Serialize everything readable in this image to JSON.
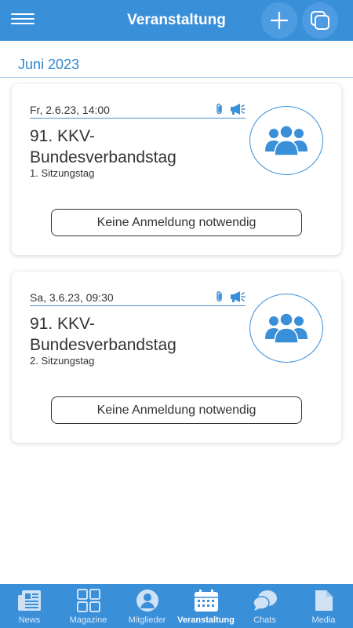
{
  "header": {
    "title": "Veranstaltung",
    "menu_icon": "hamburger-menu-icon",
    "add_icon": "plus-icon",
    "copy_icon": "copy-icon"
  },
  "month": "Juni 2023",
  "events": [
    {
      "datetime": "Fr, 2.6.23, 14:00",
      "title": "91. KKV-Bundesverbandstag",
      "subtitle": "1. Sitzungstag",
      "registration": "Keine Anmeldung notwendig",
      "icons": [
        "paperclip-icon",
        "megaphone-icon",
        "group-icon"
      ]
    },
    {
      "datetime": "Sa, 3.6.23, 09:30",
      "title": "91. KKV-Bundesverbandstag",
      "subtitle": "2. Sitzungstag",
      "registration": "Keine Anmeldung notwendig",
      "icons": [
        "paperclip-icon",
        "megaphone-icon",
        "group-icon"
      ]
    }
  ],
  "bottom_nav": [
    {
      "label": "News",
      "icon": "newspaper-icon",
      "active": false
    },
    {
      "label": "Magazine",
      "icon": "grid-icon",
      "active": false
    },
    {
      "label": "Mitglieder",
      "icon": "person-icon",
      "active": false
    },
    {
      "label": "Veranstaltung",
      "icon": "calendar-icon",
      "active": true
    },
    {
      "label": "Chats",
      "icon": "chat-bubbles-icon",
      "active": false
    },
    {
      "label": "Media",
      "icon": "document-icon",
      "active": false
    }
  ],
  "colors": {
    "primary": "#3a8fd9",
    "text": "#333333",
    "background": "#ffffff"
  }
}
